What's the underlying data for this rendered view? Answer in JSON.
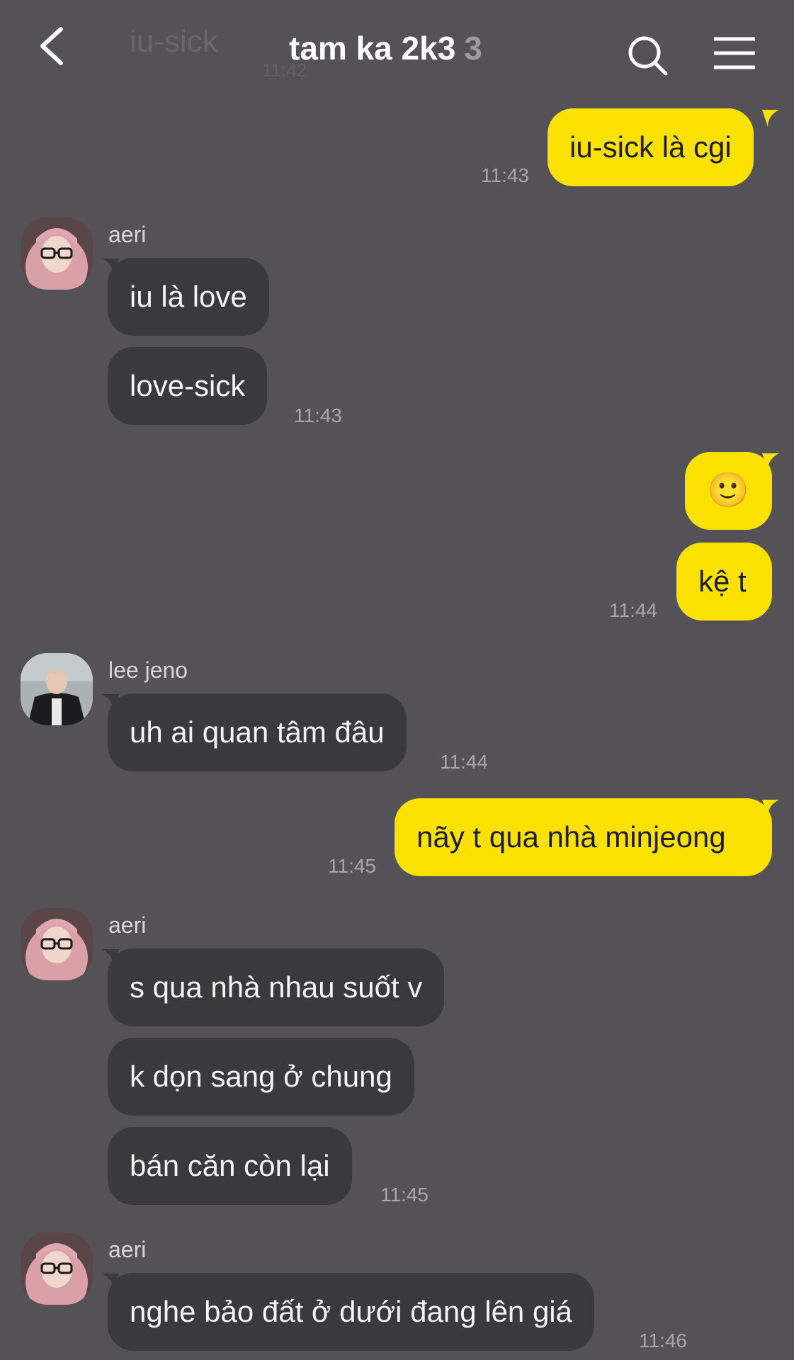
{
  "header": {
    "ghost_message": "iu-sick",
    "ghost_time": "11:42",
    "title": "tam ka 2k3",
    "member_count": "3",
    "icons": {
      "back": "back-arrow-icon",
      "search": "search-icon",
      "menu": "menu-icon"
    }
  },
  "colors": {
    "background": "#545256",
    "my_bubble": "#fae100",
    "their_bubble": "#3a393c",
    "timestamp": "#a8a6ab"
  },
  "messages": [
    {
      "text": "iu-sick là cgi",
      "time": "11:43"
    },
    {
      "sender": "aeri",
      "text1": "iu là love",
      "text2": "love-sick",
      "time": "11:43"
    },
    {
      "text1": "🙂",
      "text2": "kệ t",
      "time": "11:44"
    },
    {
      "sender": "lee jeno",
      "text": "uh ai quan tâm đâu",
      "time": "11:44"
    },
    {
      "text": "nãy t qua nhà minjeong",
      "time": "11:45"
    },
    {
      "sender": "aeri",
      "text1": "s qua nhà nhau suốt v",
      "text2": "k dọn sang ở chung",
      "text3": "bán căn còn lại",
      "time": "11:45"
    },
    {
      "sender": "aeri",
      "text": "nghe bảo đất ở dưới đang lên giá",
      "time": "11:46"
    }
  ]
}
